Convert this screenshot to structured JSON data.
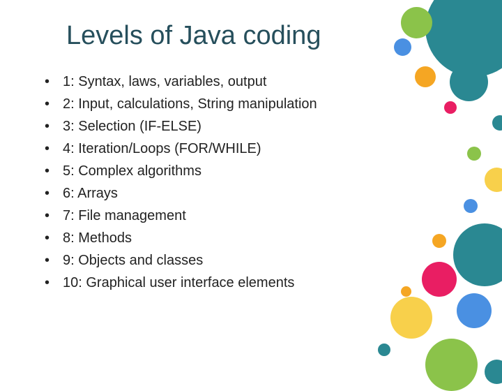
{
  "title": "Levels of Java coding",
  "items": [
    "1: Syntax, laws, variables, output",
    "2: Input, calculations, String manipulation",
    "3: Selection (IF-ELSE)",
    "4: Iteration/Loops (FOR/WHILE)",
    "5: Complex algorithms",
    "6: Arrays",
    "7: File management",
    "8: Methods",
    "9: Objects and classes",
    "10: Graphical user interface elements"
  ],
  "colors": {
    "teal": "#2a8892",
    "green": "#8bc34a",
    "orange": "#f5a623",
    "blue": "#4a90e2",
    "pink": "#e91e63",
    "yellow": "#f8d04b"
  }
}
